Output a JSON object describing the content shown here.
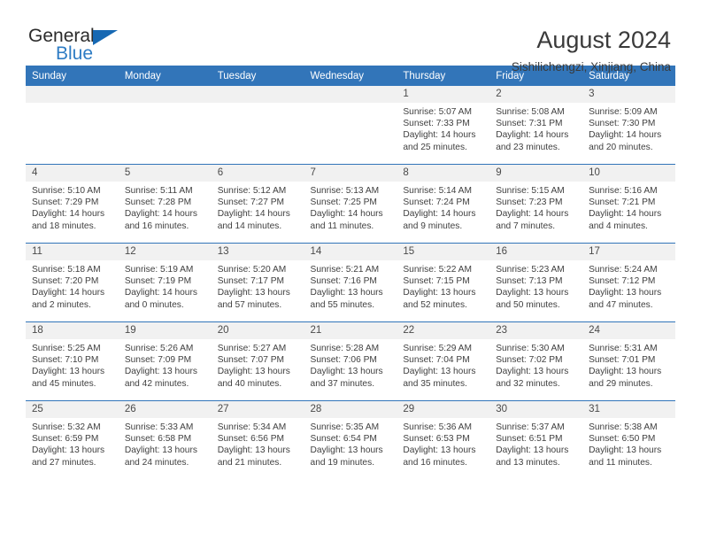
{
  "brand": {
    "name_top": "General",
    "name_bottom": "Blue"
  },
  "header": {
    "title": "August 2024",
    "subtitle": "Sishilichengzi, Xinjiang, China"
  },
  "colors": {
    "header_blue": "#3275b9",
    "logo_blue": "#2e7cc4",
    "daynum_band": "#f1f1f1",
    "text": "#404040"
  },
  "labels": {
    "sunrise_prefix": "Sunrise:",
    "sunset_prefix": "Sunset:",
    "daylight_prefix": "Daylight:"
  },
  "weekday_headers": [
    "Sunday",
    "Monday",
    "Tuesday",
    "Wednesday",
    "Thursday",
    "Friday",
    "Saturday"
  ],
  "weeks": [
    [
      {
        "day": "",
        "empty": true
      },
      {
        "day": "",
        "empty": true
      },
      {
        "day": "",
        "empty": true
      },
      {
        "day": "",
        "empty": true
      },
      {
        "day": "1",
        "sunrise": "Sunrise: 5:07 AM",
        "sunset": "Sunset: 7:33 PM",
        "daylight": "Daylight: 14 hours and 25 minutes."
      },
      {
        "day": "2",
        "sunrise": "Sunrise: 5:08 AM",
        "sunset": "Sunset: 7:31 PM",
        "daylight": "Daylight: 14 hours and 23 minutes."
      },
      {
        "day": "3",
        "sunrise": "Sunrise: 5:09 AM",
        "sunset": "Sunset: 7:30 PM",
        "daylight": "Daylight: 14 hours and 20 minutes."
      }
    ],
    [
      {
        "day": "4",
        "sunrise": "Sunrise: 5:10 AM",
        "sunset": "Sunset: 7:29 PM",
        "daylight": "Daylight: 14 hours and 18 minutes."
      },
      {
        "day": "5",
        "sunrise": "Sunrise: 5:11 AM",
        "sunset": "Sunset: 7:28 PM",
        "daylight": "Daylight: 14 hours and 16 minutes."
      },
      {
        "day": "6",
        "sunrise": "Sunrise: 5:12 AM",
        "sunset": "Sunset: 7:27 PM",
        "daylight": "Daylight: 14 hours and 14 minutes."
      },
      {
        "day": "7",
        "sunrise": "Sunrise: 5:13 AM",
        "sunset": "Sunset: 7:25 PM",
        "daylight": "Daylight: 14 hours and 11 minutes."
      },
      {
        "day": "8",
        "sunrise": "Sunrise: 5:14 AM",
        "sunset": "Sunset: 7:24 PM",
        "daylight": "Daylight: 14 hours and 9 minutes."
      },
      {
        "day": "9",
        "sunrise": "Sunrise: 5:15 AM",
        "sunset": "Sunset: 7:23 PM",
        "daylight": "Daylight: 14 hours and 7 minutes."
      },
      {
        "day": "10",
        "sunrise": "Sunrise: 5:16 AM",
        "sunset": "Sunset: 7:21 PM",
        "daylight": "Daylight: 14 hours and 4 minutes."
      }
    ],
    [
      {
        "day": "11",
        "sunrise": "Sunrise: 5:18 AM",
        "sunset": "Sunset: 7:20 PM",
        "daylight": "Daylight: 14 hours and 2 minutes."
      },
      {
        "day": "12",
        "sunrise": "Sunrise: 5:19 AM",
        "sunset": "Sunset: 7:19 PM",
        "daylight": "Daylight: 14 hours and 0 minutes."
      },
      {
        "day": "13",
        "sunrise": "Sunrise: 5:20 AM",
        "sunset": "Sunset: 7:17 PM",
        "daylight": "Daylight: 13 hours and 57 minutes."
      },
      {
        "day": "14",
        "sunrise": "Sunrise: 5:21 AM",
        "sunset": "Sunset: 7:16 PM",
        "daylight": "Daylight: 13 hours and 55 minutes."
      },
      {
        "day": "15",
        "sunrise": "Sunrise: 5:22 AM",
        "sunset": "Sunset: 7:15 PM",
        "daylight": "Daylight: 13 hours and 52 minutes."
      },
      {
        "day": "16",
        "sunrise": "Sunrise: 5:23 AM",
        "sunset": "Sunset: 7:13 PM",
        "daylight": "Daylight: 13 hours and 50 minutes."
      },
      {
        "day": "17",
        "sunrise": "Sunrise: 5:24 AM",
        "sunset": "Sunset: 7:12 PM",
        "daylight": "Daylight: 13 hours and 47 minutes."
      }
    ],
    [
      {
        "day": "18",
        "sunrise": "Sunrise: 5:25 AM",
        "sunset": "Sunset: 7:10 PM",
        "daylight": "Daylight: 13 hours and 45 minutes."
      },
      {
        "day": "19",
        "sunrise": "Sunrise: 5:26 AM",
        "sunset": "Sunset: 7:09 PM",
        "daylight": "Daylight: 13 hours and 42 minutes."
      },
      {
        "day": "20",
        "sunrise": "Sunrise: 5:27 AM",
        "sunset": "Sunset: 7:07 PM",
        "daylight": "Daylight: 13 hours and 40 minutes."
      },
      {
        "day": "21",
        "sunrise": "Sunrise: 5:28 AM",
        "sunset": "Sunset: 7:06 PM",
        "daylight": "Daylight: 13 hours and 37 minutes."
      },
      {
        "day": "22",
        "sunrise": "Sunrise: 5:29 AM",
        "sunset": "Sunset: 7:04 PM",
        "daylight": "Daylight: 13 hours and 35 minutes."
      },
      {
        "day": "23",
        "sunrise": "Sunrise: 5:30 AM",
        "sunset": "Sunset: 7:02 PM",
        "daylight": "Daylight: 13 hours and 32 minutes."
      },
      {
        "day": "24",
        "sunrise": "Sunrise: 5:31 AM",
        "sunset": "Sunset: 7:01 PM",
        "daylight": "Daylight: 13 hours and 29 minutes."
      }
    ],
    [
      {
        "day": "25",
        "sunrise": "Sunrise: 5:32 AM",
        "sunset": "Sunset: 6:59 PM",
        "daylight": "Daylight: 13 hours and 27 minutes."
      },
      {
        "day": "26",
        "sunrise": "Sunrise: 5:33 AM",
        "sunset": "Sunset: 6:58 PM",
        "daylight": "Daylight: 13 hours and 24 minutes."
      },
      {
        "day": "27",
        "sunrise": "Sunrise: 5:34 AM",
        "sunset": "Sunset: 6:56 PM",
        "daylight": "Daylight: 13 hours and 21 minutes."
      },
      {
        "day": "28",
        "sunrise": "Sunrise: 5:35 AM",
        "sunset": "Sunset: 6:54 PM",
        "daylight": "Daylight: 13 hours and 19 minutes."
      },
      {
        "day": "29",
        "sunrise": "Sunrise: 5:36 AM",
        "sunset": "Sunset: 6:53 PM",
        "daylight": "Daylight: 13 hours and 16 minutes."
      },
      {
        "day": "30",
        "sunrise": "Sunrise: 5:37 AM",
        "sunset": "Sunset: 6:51 PM",
        "daylight": "Daylight: 13 hours and 13 minutes."
      },
      {
        "day": "31",
        "sunrise": "Sunrise: 5:38 AM",
        "sunset": "Sunset: 6:50 PM",
        "daylight": "Daylight: 13 hours and 11 minutes."
      }
    ]
  ]
}
